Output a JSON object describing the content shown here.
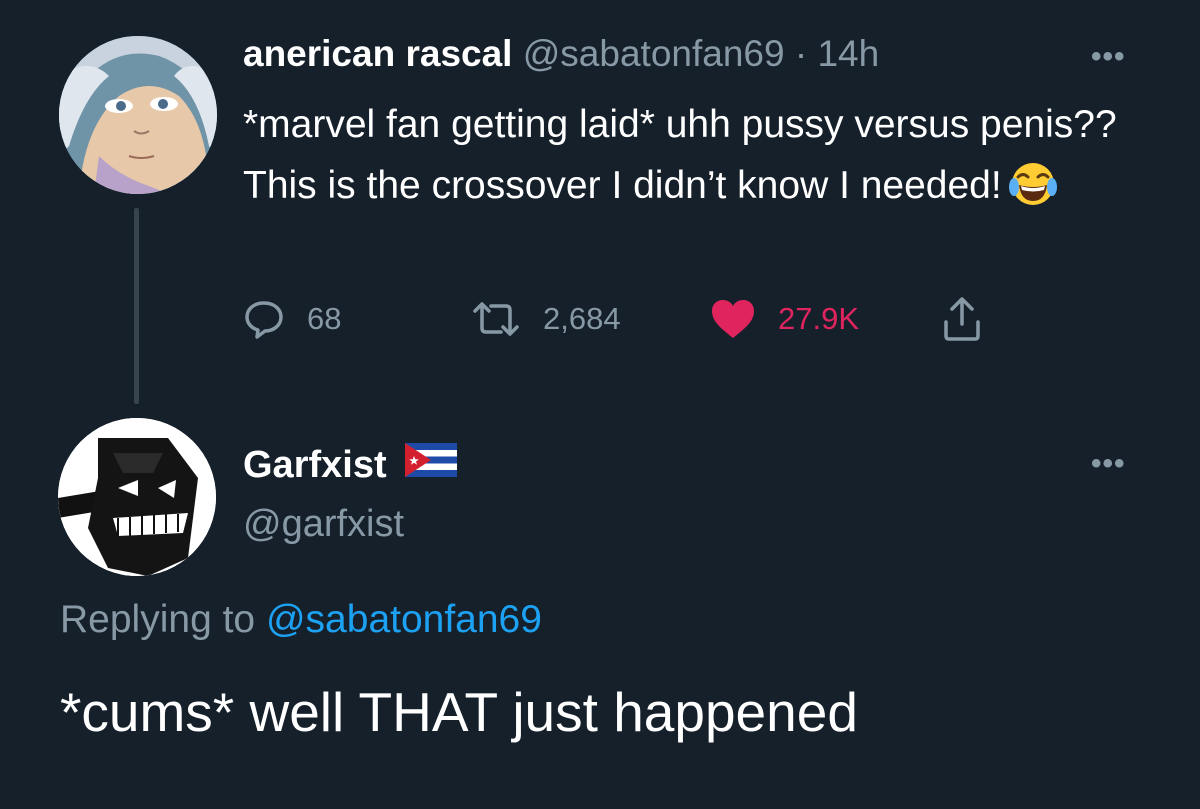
{
  "tweet": {
    "display_name": "anerican rascal",
    "handle": "@sabatonfan69",
    "separator": "·",
    "timestamp": "14h",
    "text": "*marvel fan getting laid* uhh pussy versus penis?? This is the crossover I didn’t know I needed!",
    "emoji": "face-with-tears-of-joy",
    "more_icon": "more-icon",
    "actions": {
      "reply_count": "68",
      "retweet_count": "2,684",
      "like_count": "27.9K",
      "liked": true
    }
  },
  "reply": {
    "display_name": "Garfxist",
    "flag": "cuba-flag",
    "handle": "@garfxist",
    "replying_prefix": "Replying to",
    "replying_to": "@sabatonfan69",
    "text": "*cums* well THAT just happened",
    "more_icon": "more-icon"
  },
  "colors": {
    "background": "#15202b",
    "secondary_text": "#8899a6",
    "link": "#1da1f2",
    "like": "#e0245e",
    "thread_line": "#38444d"
  }
}
